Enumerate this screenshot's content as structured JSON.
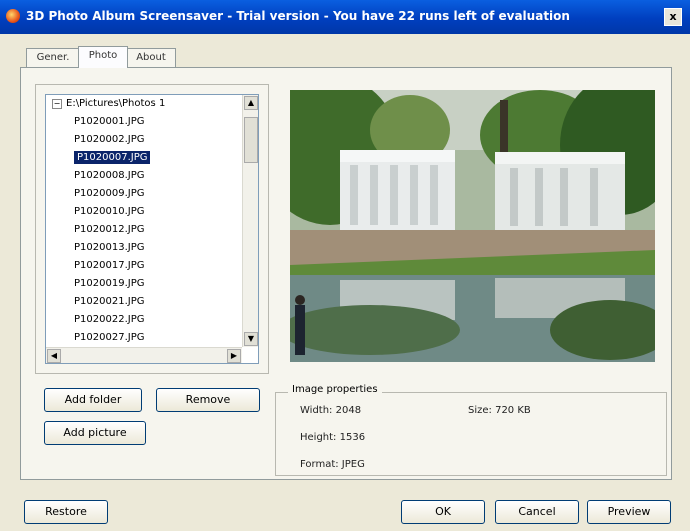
{
  "window": {
    "title": "3D Photo Album Screensaver - Trial version - You have 22 runs left of evaluation",
    "close_label": "x"
  },
  "tabs": [
    {
      "label": "Gener."
    },
    {
      "label": "Photo"
    },
    {
      "label": "About"
    }
  ],
  "tree": {
    "root_label": "E:\\Pictures\\Photos 1",
    "items": [
      {
        "label": "P1020001.JPG"
      },
      {
        "label": "P1020002.JPG"
      },
      {
        "label": "P1020007.JPG",
        "selected": true
      },
      {
        "label": "P1020008.JPG"
      },
      {
        "label": "P1020009.JPG"
      },
      {
        "label": "P1020010.JPG"
      },
      {
        "label": "P1020012.JPG"
      },
      {
        "label": "P1020013.JPG"
      },
      {
        "label": "P1020017.JPG"
      },
      {
        "label": "P1020019.JPG"
      },
      {
        "label": "P1020021.JPG"
      },
      {
        "label": "P1020022.JPG"
      },
      {
        "label": "P1020027.JPG"
      }
    ]
  },
  "buttons": {
    "add_folder": "Add folder",
    "remove": "Remove",
    "add_picture": "Add picture",
    "restore": "Restore",
    "ok": "OK",
    "cancel": "Cancel",
    "preview": "Preview"
  },
  "image_properties": {
    "legend": "Image properties",
    "width": "Width: 2048",
    "size": "Size: 720 KB",
    "height": "Height: 1536",
    "format": "Format: JPEG"
  }
}
